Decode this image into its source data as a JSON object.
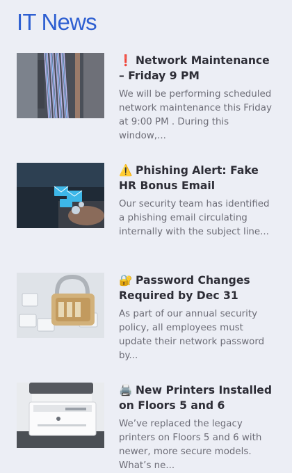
{
  "page": {
    "title": "IT News"
  },
  "articles": [
    {
      "icon": "exclamation-icon",
      "emoji": "❗",
      "title": "Network Maintenance – Friday 9 PM",
      "excerpt": "We will be performing scheduled network maintenance this Friday at 9:00 PM . During this window,..."
    },
    {
      "icon": "warning-icon",
      "emoji": "⚠️",
      "title": "Phishing Alert: Fake HR Bonus Email",
      "excerpt": "Our security team has identified a phishing email circulating internally with the subject line..."
    },
    {
      "icon": "lock-icon",
      "emoji": "🔐",
      "title": "Password Changes Required by Dec 31",
      "excerpt": "As part of our annual security policy, all employees must update their network password by..."
    },
    {
      "icon": "printer-icon",
      "emoji": "🖨️",
      "title": "New Printers Installed on Floors 5 and 6",
      "excerpt": "We’ve replaced the legacy printers on Floors 5 and 6 with newer, more secure models. What’s ne..."
    }
  ],
  "colors": {
    "title": "#2e5fd1",
    "background": "#eceef5",
    "headline": "#2d2d36",
    "excerpt": "#6c6c76"
  }
}
